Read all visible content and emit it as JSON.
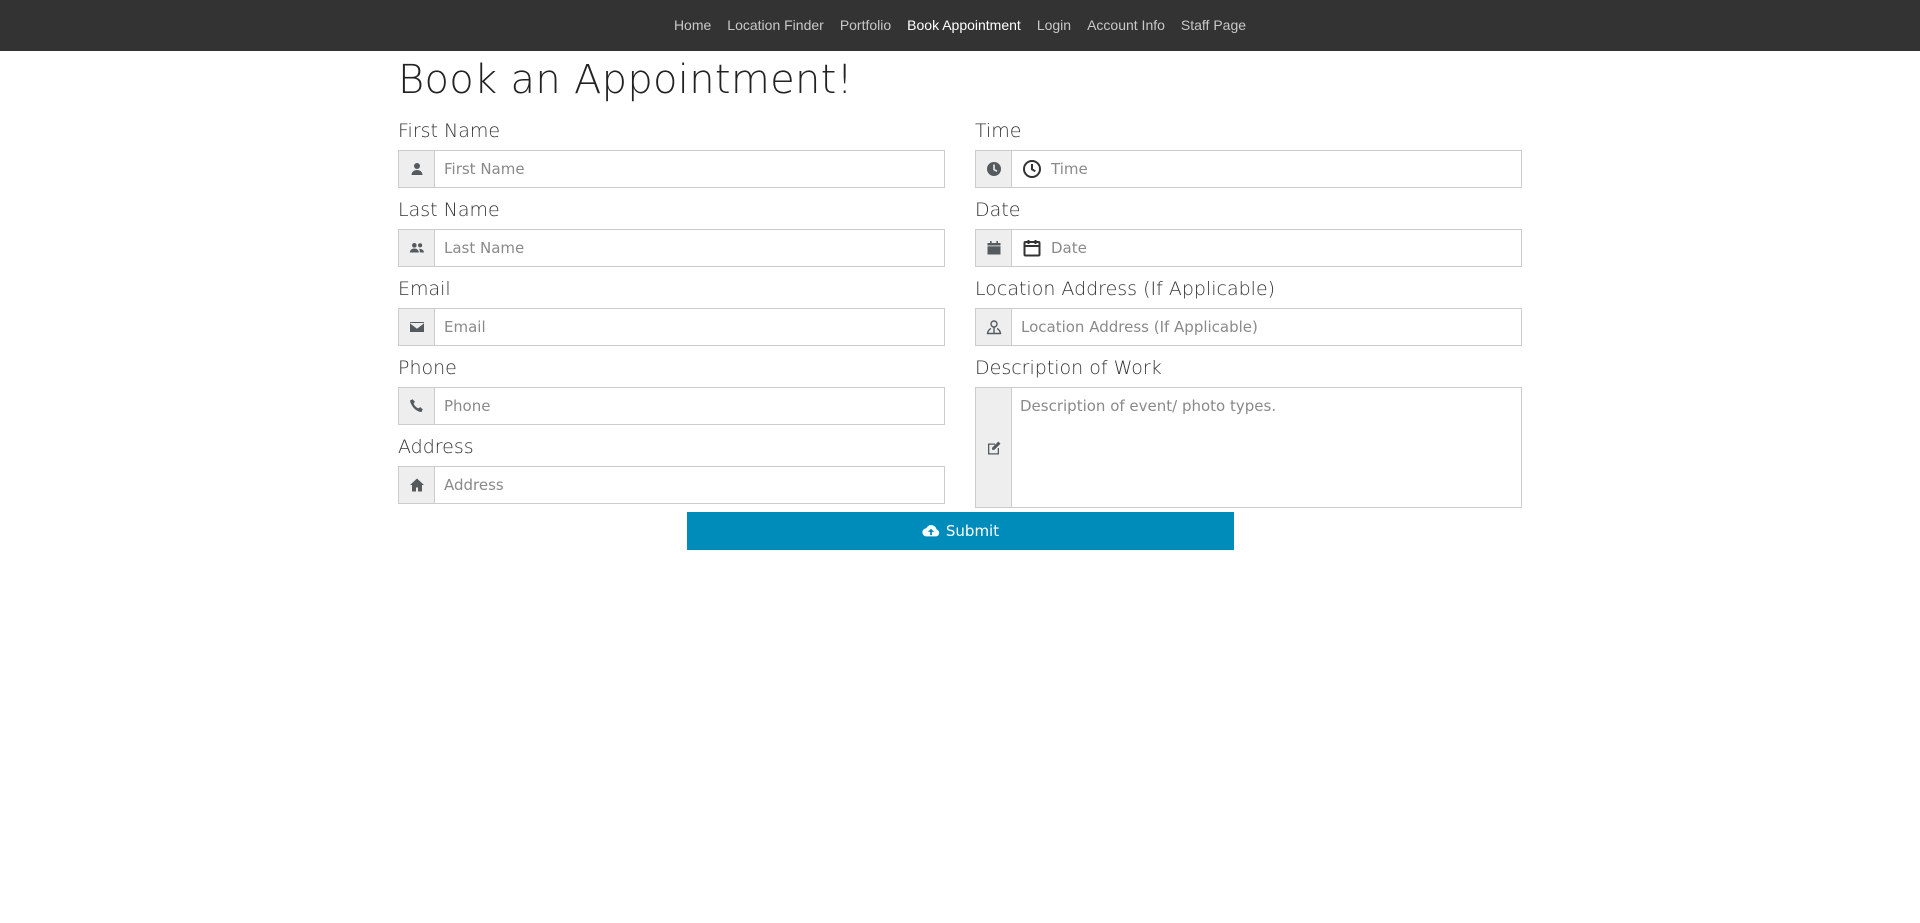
{
  "nav": {
    "items": [
      {
        "label": "Home"
      },
      {
        "label": "Location Finder"
      },
      {
        "label": "Portfolio"
      },
      {
        "label": "Book Appointment"
      },
      {
        "label": "Login"
      },
      {
        "label": "Account Info"
      },
      {
        "label": "Staff Page"
      }
    ],
    "active": "Book Appointment"
  },
  "page": {
    "title": "Book an Appointment!"
  },
  "form": {
    "first_name": {
      "label": "First Name",
      "placeholder": "First Name",
      "icon": "user-icon"
    },
    "last_name": {
      "label": "Last Name",
      "placeholder": "Last Name",
      "icon": "users-icon"
    },
    "email": {
      "label": "Email",
      "placeholder": "Email",
      "icon": "envelope-icon"
    },
    "phone": {
      "label": "Phone",
      "placeholder": "Phone",
      "icon": "phone-icon"
    },
    "address": {
      "label": "Address",
      "placeholder": "Address",
      "icon": "home-icon"
    },
    "time": {
      "label": "Time",
      "placeholder": "Time",
      "icon": "clock-icon"
    },
    "date": {
      "label": "Date",
      "placeholder": "Date",
      "icon": "calendar-icon"
    },
    "location": {
      "label": "Location Address (If Applicable)",
      "placeholder": "Location Address (If Applicable)",
      "icon": "map-pin-user-icon"
    },
    "description": {
      "label": "Description of Work",
      "placeholder": "Description of event/ photo types.",
      "icon": "edit-icon"
    },
    "submit": {
      "label": "Submit",
      "icon": "cloud-upload-icon"
    }
  },
  "colors": {
    "navbar_bg": "#333333",
    "accent": "#008cba"
  }
}
